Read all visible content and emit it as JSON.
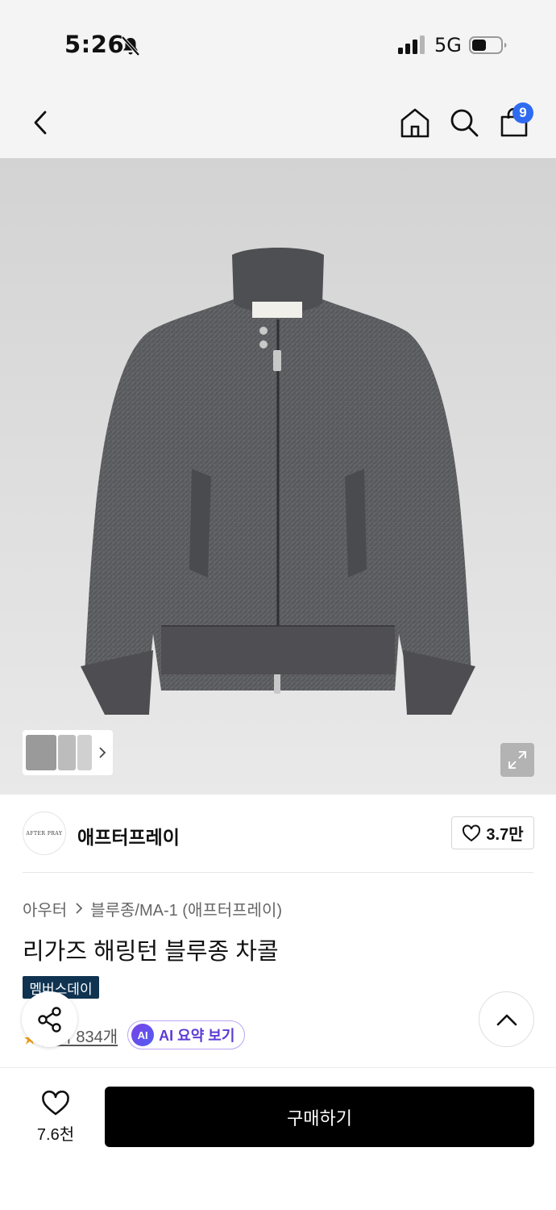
{
  "status_bar": {
    "time": "5:26",
    "network": "5G",
    "icons": [
      "bell-off-icon",
      "signal-icon",
      "battery-icon"
    ]
  },
  "nav": {
    "icons": [
      "back-icon",
      "home-icon",
      "search-icon",
      "cart-icon"
    ],
    "cart_badge": "9"
  },
  "gallery": {
    "thumbnail_count": 3,
    "icons": [
      "chevron-right-icon",
      "expand-icon"
    ]
  },
  "brand": {
    "logo_text": "AFTER PRAY",
    "name": "애프터프레이",
    "like_count": "3.7만"
  },
  "product": {
    "breadcrumb": [
      "아우터",
      "블루종/MA-1 (애프터프레이)"
    ],
    "title": "리가즈 해링턴 블루종 차콜",
    "badge": "멤버스데이",
    "review_text": "후기 834개",
    "ai_icon_text": "AI",
    "ai_summary_label": "AI 요약 보기"
  },
  "bottom_bar": {
    "wish_count": "7.6천",
    "buy_label": "구매하기"
  },
  "colors": {
    "buy_button": "#000000",
    "member_badge": "#0f3351",
    "cart_badge": "#2f6bf0",
    "ai_accent": "#5d3bd6"
  }
}
